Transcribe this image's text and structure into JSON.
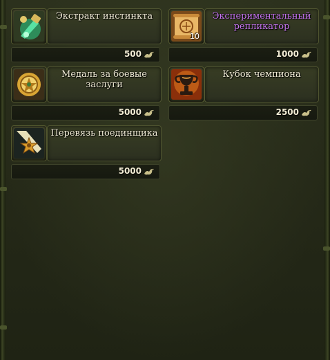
{
  "items": [
    {
      "name": "Экстракт инстинкта",
      "price": "500",
      "icon": "extract-icon",
      "rarity": "common"
    },
    {
      "name": "Экспериментальный репликатор",
      "price": "1000",
      "icon": "replicator-scroll-icon",
      "count": "10",
      "rarity": "epic"
    },
    {
      "name": "Медаль за боевые заслуги",
      "price": "5000",
      "icon": "medal-icon",
      "rarity": "common"
    },
    {
      "name": "Кубок чемпиона",
      "price": "2500",
      "icon": "cup-icon",
      "rarity": "common"
    },
    {
      "name": "Перевязь поединщика",
      "price": "5000",
      "icon": "sash-icon",
      "rarity": "common"
    }
  ],
  "currency_icon": "bird-currency-icon",
  "colors": {
    "epic_name": "#c776f2",
    "name": "#f1ecd6",
    "price": "#f3edd5",
    "currency": "#c9c08a"
  }
}
